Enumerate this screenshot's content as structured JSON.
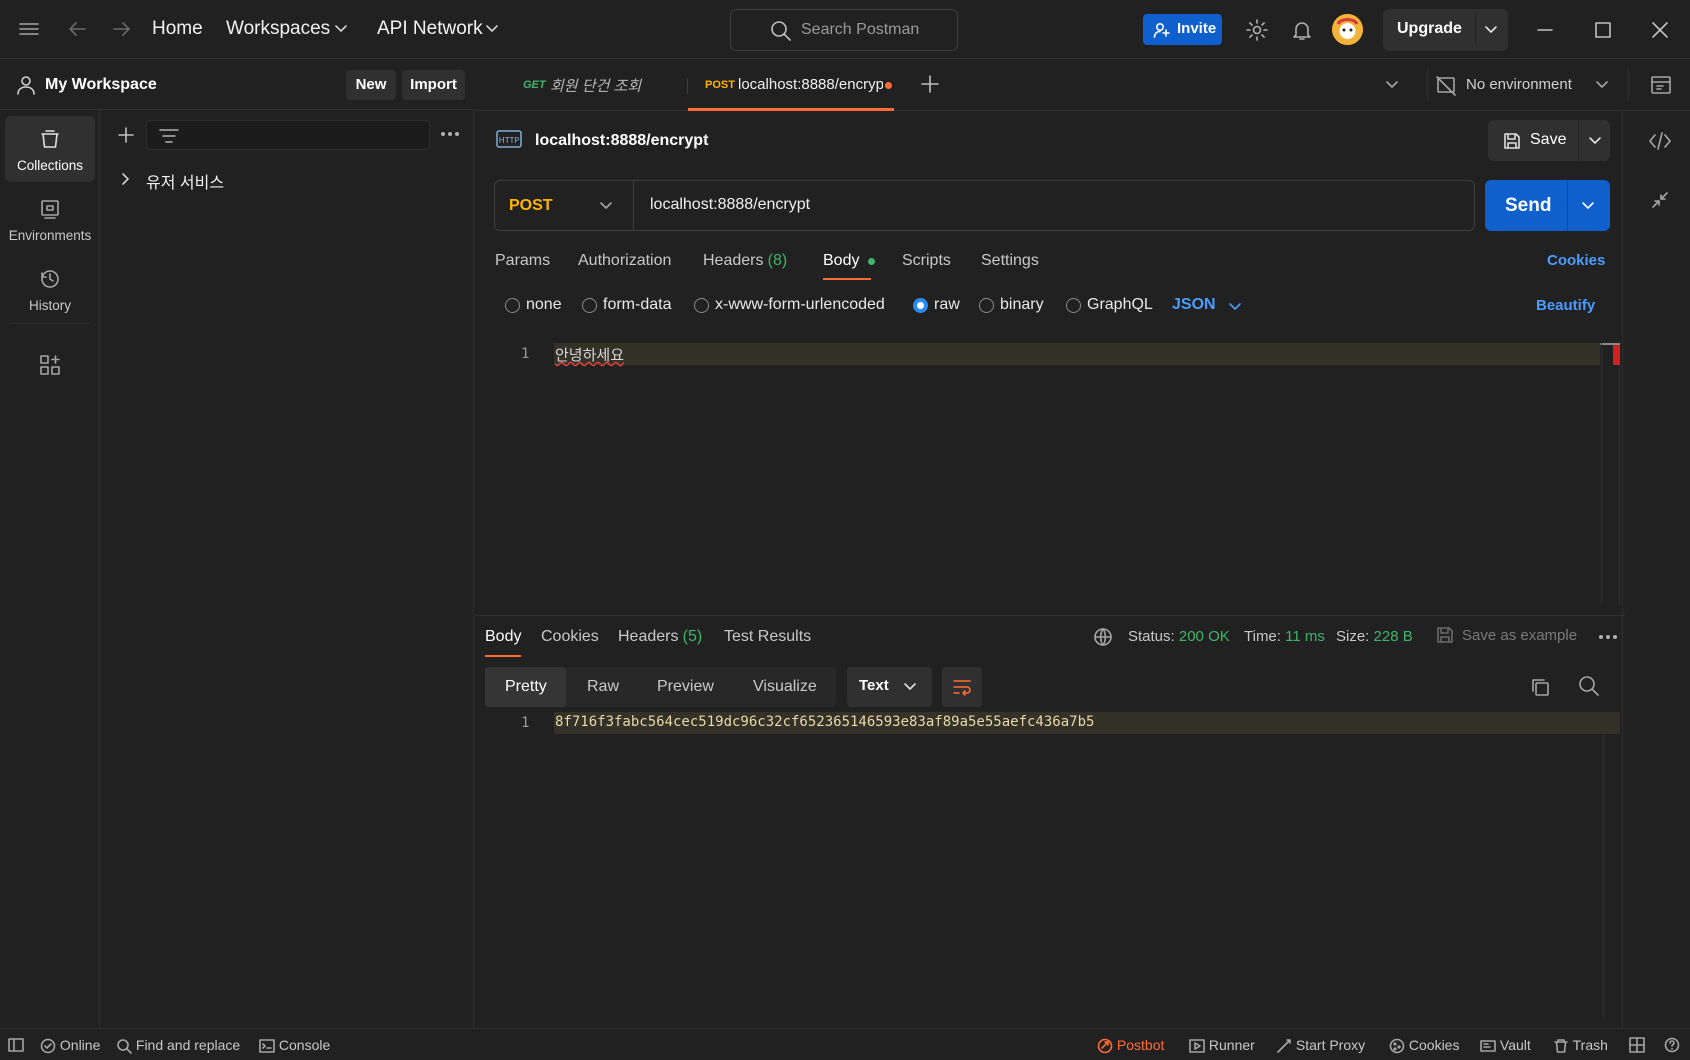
{
  "topbar": {
    "home": "Home",
    "workspaces": "Workspaces",
    "api_network": "API Network",
    "search_placeholder": "Search Postman",
    "invite": "Invite",
    "upgrade": "Upgrade"
  },
  "sidebar": {
    "workspace_name": "My Workspace",
    "new_label": "New",
    "import_label": "Import",
    "rail": [
      {
        "label": "Collections",
        "icon": "collections-icon",
        "active": true
      },
      {
        "label": "Environments",
        "icon": "environments-icon"
      },
      {
        "label": "History",
        "icon": "history-icon"
      }
    ],
    "collections": [
      {
        "name": "유저 서비스"
      }
    ]
  },
  "tabs": [
    {
      "method": "GET",
      "title": "회원 단건 조회",
      "method_color": "#3fb56a"
    },
    {
      "method": "POST",
      "title": "localhost:8888/encryp",
      "method_color": "#ffb400",
      "active": true,
      "unsaved": true
    }
  ],
  "environment": "No environment",
  "request": {
    "name": "localhost:8888/encrypt",
    "method": "POST",
    "url": "localhost:8888/encrypt",
    "save_label": "Save",
    "send_label": "Send",
    "subtabs": {
      "params": "Params",
      "authorization": "Authorization",
      "headers": "Headers",
      "headers_count": "(8)",
      "body": "Body",
      "scripts": "Scripts",
      "settings": "Settings",
      "cookies": "Cookies"
    },
    "body_modes": [
      "none",
      "form-data",
      "x-www-form-urlencoded",
      "raw",
      "binary",
      "GraphQL"
    ],
    "body_mode_selected": "raw",
    "format": "JSON",
    "beautify": "Beautify",
    "body_lines": [
      {
        "num": "1",
        "text": "안녕하세요"
      }
    ]
  },
  "response": {
    "tabs": {
      "body": "Body",
      "cookies": "Cookies",
      "headers": "Headers",
      "headers_count": "(5)",
      "test_results": "Test Results"
    },
    "status_label": "Status:",
    "status": "200 OK",
    "time_label": "Time:",
    "time": "11 ms",
    "size_label": "Size:",
    "size": "228 B",
    "save_example": "Save as example",
    "views": [
      "Pretty",
      "Raw",
      "Preview",
      "Visualize"
    ],
    "format": "Text",
    "lines": [
      {
        "num": "1",
        "text": "8f716f3fabc564cec519dc96c32cf652365146593e83af89a5e55aefc436a7b5"
      }
    ]
  },
  "footer": {
    "online": "Online",
    "find_replace": "Find and replace",
    "console": "Console",
    "postbot": "Postbot",
    "runner": "Runner",
    "start_proxy": "Start Proxy",
    "cookies": "Cookies",
    "vault": "Vault",
    "trash": "Trash"
  },
  "colors": {
    "accent_orange": "#ff6c37",
    "primary_blue": "#0f5fcd",
    "success_green": "#3fb56a",
    "post_yellow": "#ffb400",
    "link_blue": "#4a9dff"
  }
}
